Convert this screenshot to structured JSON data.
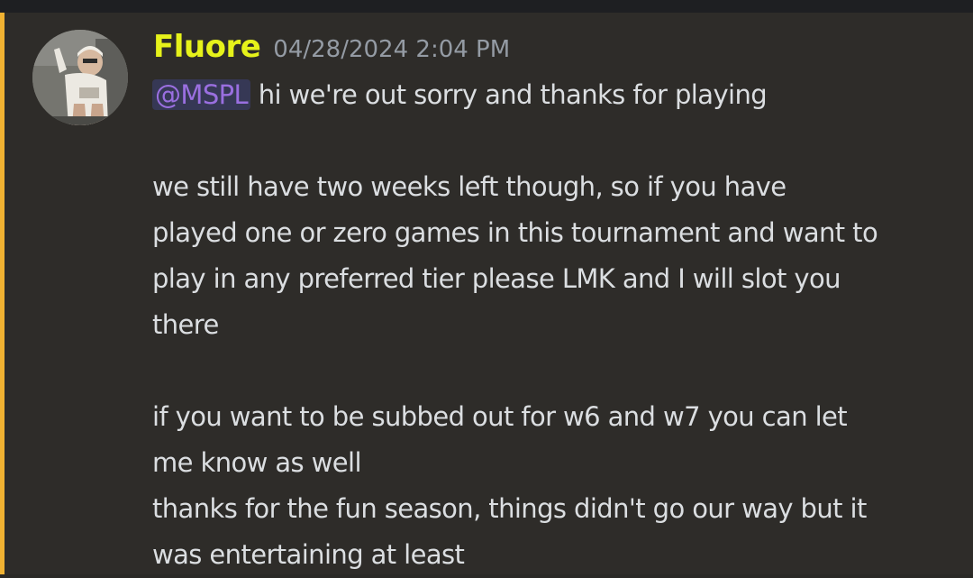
{
  "message": {
    "username": "Fluore",
    "timestamp": "04/28/2024 2:04 PM",
    "mention": "@MSPL",
    "lines": [
      " hi we're out sorry and thanks for playing",
      "we still have two weeks left though, so if you have",
      "played one or zero games in this tournament and want to",
      "play in any preferred tier please LMK and I will slot you",
      "there",
      "if you want to be subbed out for w6 and w7 you can let",
      "me know as well",
      "thanks for the fun season, things didn't go our way but it",
      "was entertaining at least"
    ]
  },
  "colors": {
    "username": "#e6f21a",
    "mention": "#9a6fe0",
    "mention_bar": "#f0b232",
    "background": "#2e2c29",
    "text": "#dbdee1",
    "timestamp": "#949ba4"
  },
  "icons": {
    "avatar": "user-avatar"
  }
}
